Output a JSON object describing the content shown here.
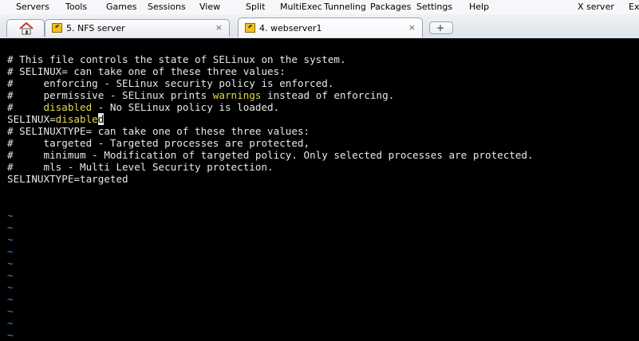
{
  "menu": {
    "items": [
      "Servers",
      "Tools",
      "Games",
      "Sessions",
      "View",
      "Split",
      "MultiExec",
      "Tunneling",
      "Packages",
      "Settings",
      "Help",
      "X server",
      "Ex"
    ]
  },
  "tabs": [
    {
      "label": "5. NFS server",
      "close": "×"
    },
    {
      "label": "4. webserver1",
      "close": "×"
    }
  ],
  "terminal": {
    "l1": "# This file controls the state of SELinux on the system.",
    "l2": "# SELINUX= can take one of these three values:",
    "l3": "#     enforcing - SELinux security policy is enforced.",
    "l4a": "#     permissive - SELinux prints ",
    "l4b": "warnings",
    "l4c": " instead of enforcing.",
    "l5a": "#     ",
    "l5b": "disabled",
    "l5c": " - No SELinux policy is loaded.",
    "l6a": "SELINUX=",
    "l6b": "disable",
    "l6cursor": "d",
    "l7": "# SELINUXTYPE= can take one of these three values:",
    "l8": "#     targeted - Targeted processes are protected,",
    "l9": "#     minimum - Modification of targeted policy. Only selected processes are protected.",
    "l10": "#     mls - Multi Level Security protection.",
    "l11": "SELINUXTYPE=targeted",
    "tilde": "~"
  },
  "colors": {
    "terminal_bg": "#000000",
    "text": "#e8e8e8",
    "highlight": "#e6d94a",
    "tilde": "#3b8ed8"
  },
  "icons": {
    "home": "home-icon",
    "session": "wrench-icon",
    "add_tab": "plus-icon"
  }
}
